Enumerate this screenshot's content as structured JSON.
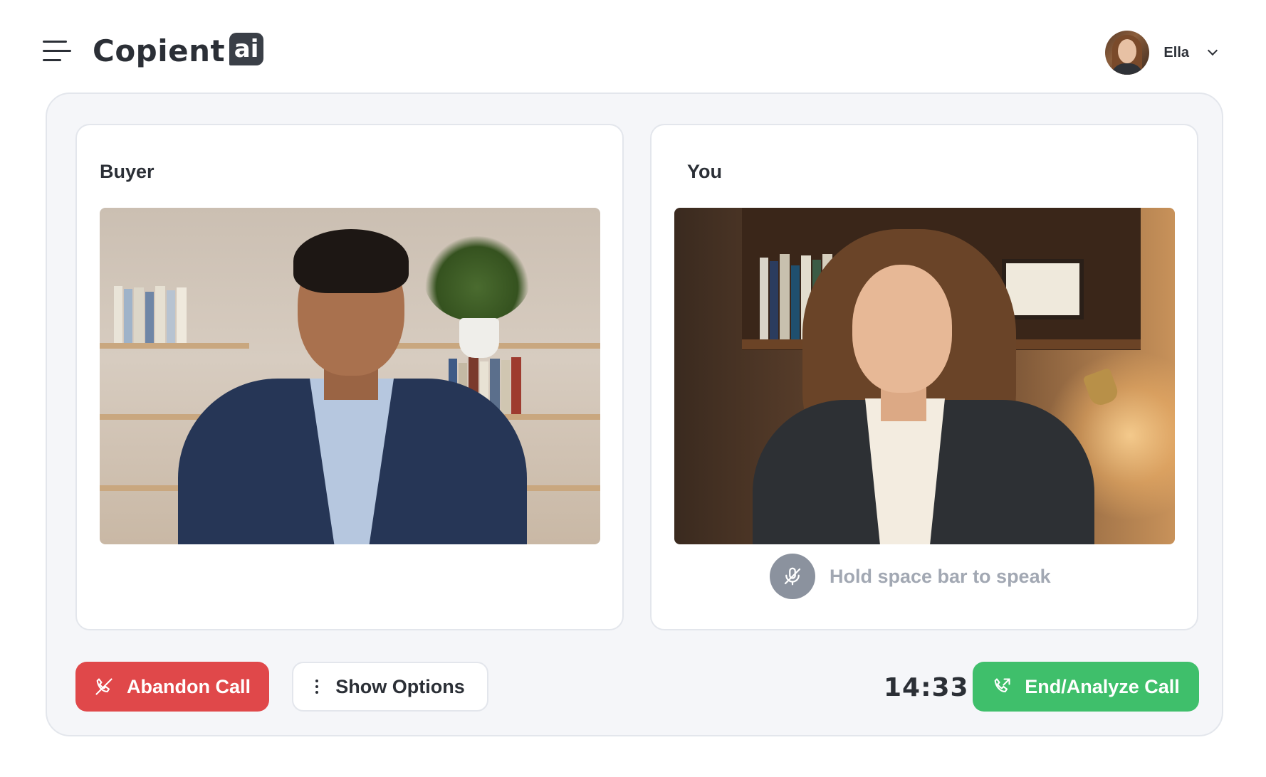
{
  "header": {
    "logo_text": "Copient",
    "logo_badge": "ai",
    "user_name": "Ella"
  },
  "panels": {
    "buyer": {
      "title": "Buyer"
    },
    "you": {
      "title": "You",
      "speak_hint": "Hold space bar to speak"
    }
  },
  "controls": {
    "abandon_label": "Abandon Call",
    "options_label": "Show Options",
    "timer": "14:33",
    "end_label": "End/Analyze Call"
  },
  "colors": {
    "abandon": "#e0484a",
    "end": "#3fbf6b",
    "background": "#f5f6f9",
    "mic": "#8b929e"
  },
  "icons": {
    "menu": "hamburger-icon",
    "user_menu": "chevron-down-icon",
    "abandon": "phone-off-icon",
    "options": "more-vertical-icon",
    "mic": "mic-off-icon",
    "end": "phone-outgoing-icon"
  }
}
